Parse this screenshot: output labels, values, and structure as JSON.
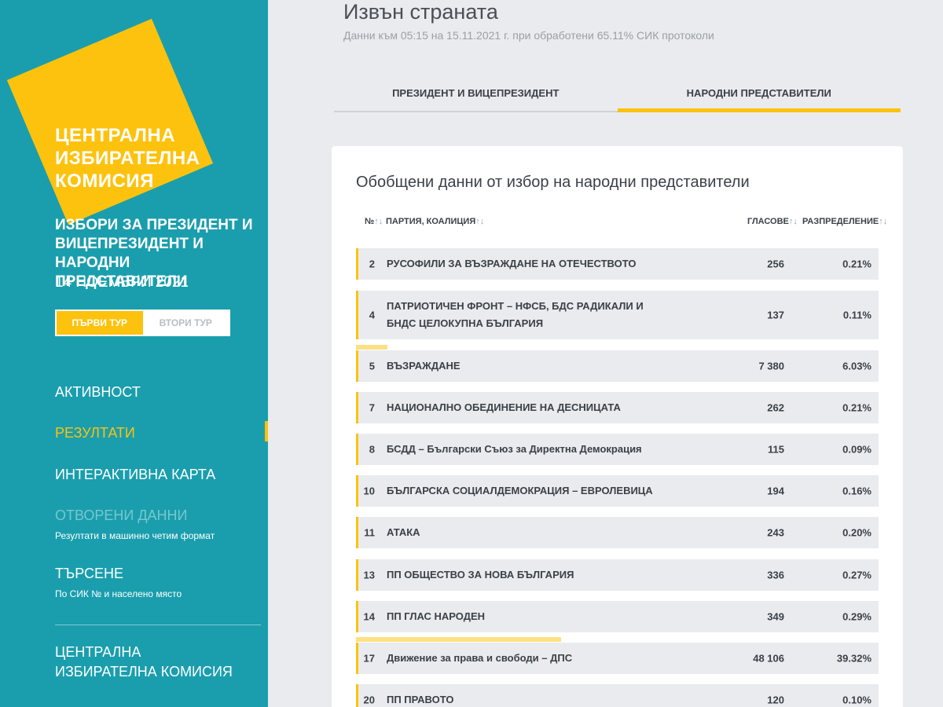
{
  "brand": {
    "logo_lines": [
      "ЦЕНТРАЛНА",
      "ИЗБИРАТЕЛНА",
      "КОМИСИЯ"
    ],
    "accent_color": "#fdc20d",
    "sidebar_color": "#1a9ead"
  },
  "election": {
    "title": "ИЗБОРИ ЗА ПРЕЗИДЕНТ И ВИЦЕПРЕЗИДЕНТ И НАРОДНИ ПРЕДСТАВИТЕЛИ",
    "date": "14 НОЕМВРИ 2021"
  },
  "rounds": {
    "first": "ПЪРВИ ТУР",
    "second": "ВТОРИ ТУР",
    "selected": "ПЪРВИ ТУР"
  },
  "nav": {
    "activity": "АКТИВНОСТ",
    "results": "РЕЗУЛТАТИ",
    "map": "ИНТЕРАКТИВНА КАРТА",
    "open_data": "ОТВОРЕНИ ДАННИ",
    "open_data_sub": "Резултати в машинно четим формат",
    "search": "ТЪРСЕНЕ",
    "search_sub": "По СИК № и населено място",
    "cik": "ЦЕНТРАЛНА ИЗБИРАТЕЛНА КОМИСИЯ"
  },
  "page": {
    "title": "Извън страната",
    "subtitle": "Данни към 05:15 на 15.11.2021 г. при обработени 65.11% СИК протоколи"
  },
  "tabs": {
    "president": "ПРЕЗИДЕНТ И ВИЦЕПРЕЗИДЕНТ",
    "parliament": "НАРОДНИ ПРЕДСТАВИТЕЛИ",
    "active": "НАРОДНИ ПРЕДСТАВИТЕЛИ"
  },
  "table": {
    "title": "Обобщени данни от избор на народни представители",
    "headers": {
      "num": "№",
      "party": "ПАРТИЯ, КОАЛИЦИЯ",
      "votes": "ГЛАСОВЕ",
      "share": "РАЗПРЕДЕЛЕНИЕ"
    },
    "sort_glyph": "↑↓",
    "rows": [
      {
        "num": "2",
        "name": "РУСОФИЛИ ЗА ВЪЗРАЖДАНЕ НА ОТЕЧЕСТВОТО",
        "votes": "256",
        "pct": "0.21%",
        "share": 0.0021
      },
      {
        "num": "4",
        "name": "ПАТРИОТИЧЕН ФРОНТ – НФСБ, БДС РАДИКАЛИ И БНДС ЦЕЛОКУПНА БЪЛГАРИЯ",
        "votes": "137",
        "pct": "0.11%",
        "share": 0.0011
      },
      {
        "num": "5",
        "name": "ВЪЗРАЖДАНЕ",
        "votes": "7 380",
        "pct": "6.03%",
        "share": 0.0603
      },
      {
        "num": "7",
        "name": "НАЦИОНАЛНО ОБЕДИНЕНИЕ НА ДЕСНИЦАТА",
        "votes": "262",
        "pct": "0.21%",
        "share": 0.0021
      },
      {
        "num": "8",
        "name": "БСДД – Български Съюз за Директна Демокрация",
        "votes": "115",
        "pct": "0.09%",
        "share": 0.0009
      },
      {
        "num": "10",
        "name": "БЪЛГАРСКА СОЦИАЛДЕМОКРАЦИЯ – ЕВРОЛЕВИЦА",
        "votes": "194",
        "pct": "0.16%",
        "share": 0.0016
      },
      {
        "num": "11",
        "name": "АТАКА",
        "votes": "243",
        "pct": "0.20%",
        "share": 0.002
      },
      {
        "num": "13",
        "name": "ПП ОБЩЕСТВО ЗА НОВА БЪЛГАРИЯ",
        "votes": "336",
        "pct": "0.27%",
        "share": 0.0027
      },
      {
        "num": "14",
        "name": "ПП ГЛАС НАРОДЕН",
        "votes": "349",
        "pct": "0.29%",
        "share": 0.0029
      },
      {
        "num": "17",
        "name": "Движение за права и свободи – ДПС",
        "votes": "48 106",
        "pct": "39.32%",
        "share": 0.3932
      },
      {
        "num": "20",
        "name": "ПП ПРАВОТО",
        "votes": "120",
        "pct": "0.10%",
        "share": 0.001
      }
    ]
  }
}
